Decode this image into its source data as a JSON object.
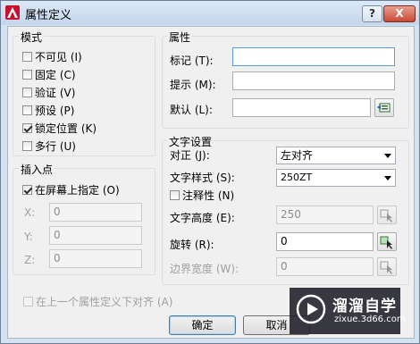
{
  "window": {
    "title": "属性定义",
    "help_label": "?",
    "close_label": "X"
  },
  "mode": {
    "title": "模式",
    "options": [
      {
        "label": "不可见 (I)",
        "checked": false
      },
      {
        "label": "固定 (C)",
        "checked": false
      },
      {
        "label": "验证 (V)",
        "checked": false
      },
      {
        "label": "预设 (P)",
        "checked": false
      },
      {
        "label": "锁定位置 (K)",
        "checked": true
      },
      {
        "label": "多行 (U)",
        "checked": false
      }
    ]
  },
  "insertion_point": {
    "title": "插入点",
    "specify_on_screen": {
      "label": "在屏幕上指定 (O)",
      "checked": true
    },
    "x": {
      "label": "X:",
      "value": "0"
    },
    "y": {
      "label": "Y:",
      "value": "0"
    },
    "z": {
      "label": "Z:",
      "value": "0"
    }
  },
  "attribute": {
    "title": "属性",
    "tag": {
      "label": "标记 (T):",
      "value": ""
    },
    "prompt": {
      "label": "提示 (M):",
      "value": ""
    },
    "default": {
      "label": "默认 (L):",
      "value": ""
    }
  },
  "text_settings": {
    "title": "文字设置",
    "justification": {
      "label": "对正 (J):",
      "value": "左对齐"
    },
    "text_style": {
      "label": "文字样式 (S):",
      "value": "250ZT"
    },
    "annotative": {
      "label": "注释性 (N)",
      "checked": false
    },
    "text_height": {
      "label": "文字高度 (E):",
      "value": "250"
    },
    "rotation": {
      "label": "旋转 (R):",
      "value": "0"
    },
    "boundary_width": {
      "label": "边界宽度 (W):",
      "value": "0"
    }
  },
  "align_below": {
    "label": "在上一个属性定义下对齐 (A)",
    "checked": false
  },
  "buttons": {
    "ok": "确定",
    "cancel": "取消"
  },
  "watermark": {
    "title": "溜溜自学",
    "subtitle": "zixue.3d66.com"
  }
}
